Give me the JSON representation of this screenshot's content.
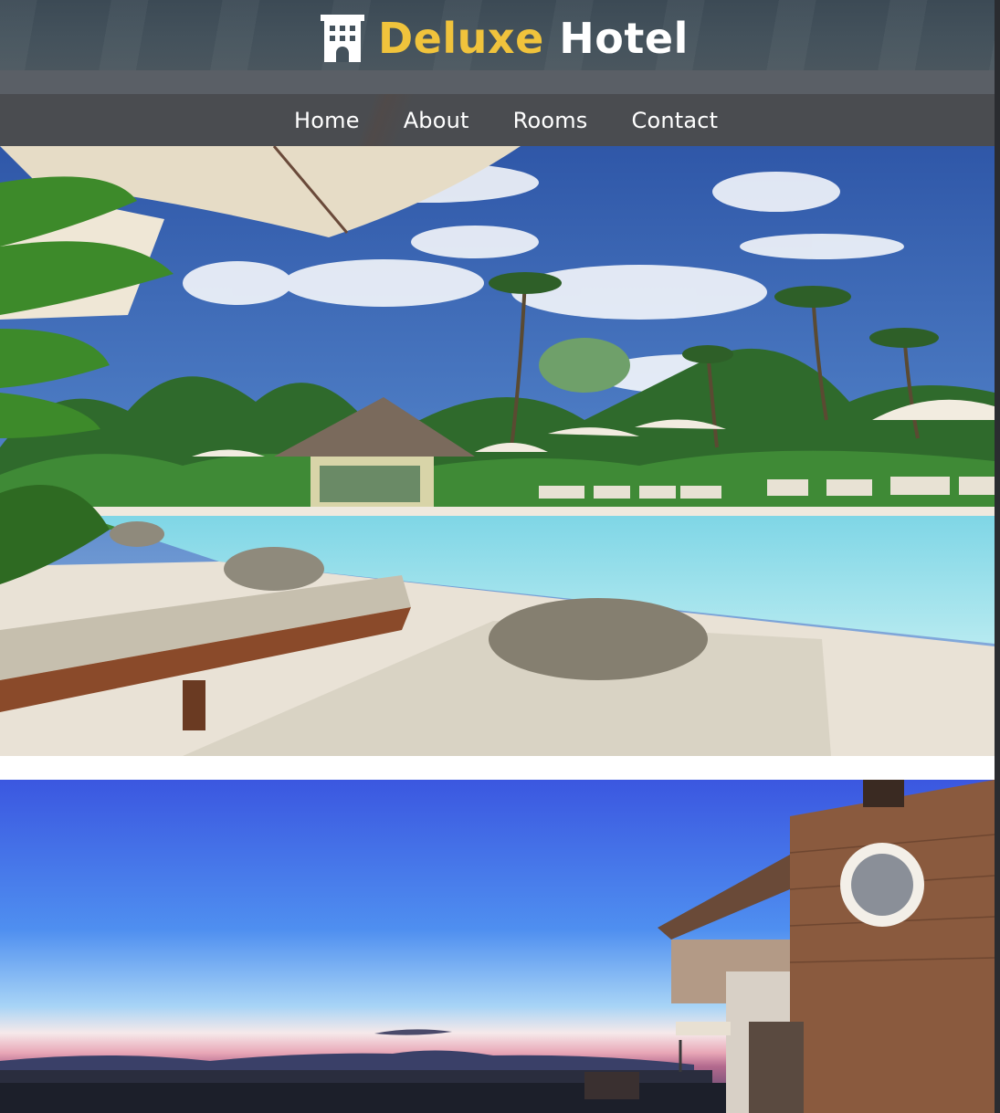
{
  "brand": {
    "name_accent": "Deluxe",
    "name_main": "Hotel",
    "icon": "hotel-building-icon",
    "colors": {
      "accent": "#f0c33c",
      "text": "#ffffff"
    }
  },
  "nav": {
    "items": [
      {
        "label": "Home"
      },
      {
        "label": "About"
      },
      {
        "label": "Rooms"
      },
      {
        "label": "Contact"
      }
    ]
  },
  "gallery": {
    "images": [
      {
        "subject": "resort-pool-photo"
      },
      {
        "subject": "sunset-hillside-villa-photo"
      }
    ]
  }
}
